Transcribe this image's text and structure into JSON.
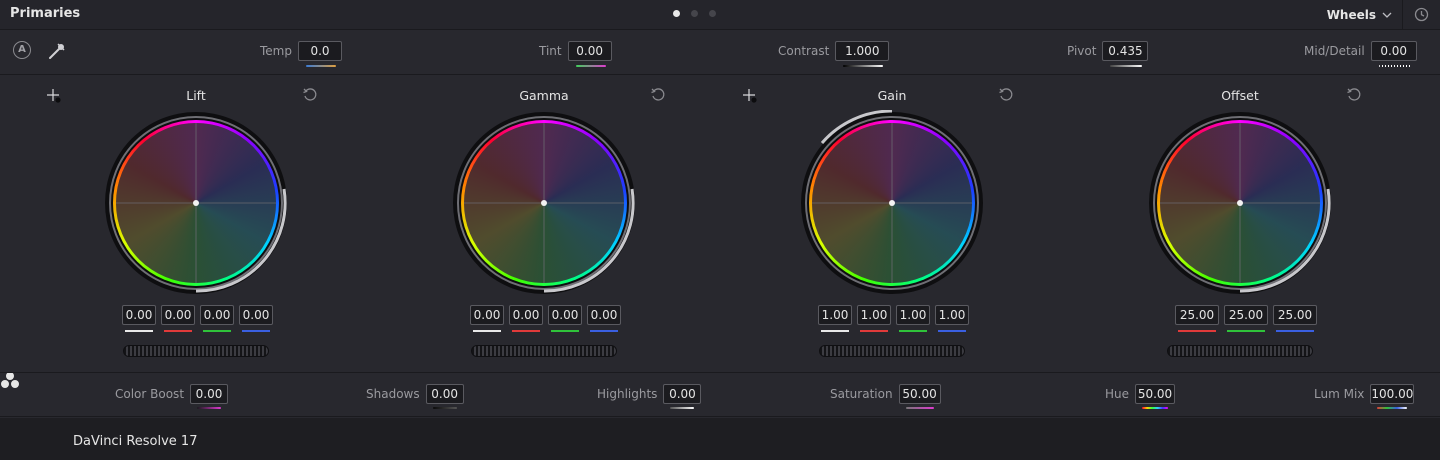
{
  "header": {
    "title": "Primaries",
    "mode": "Wheels",
    "pages": [
      true,
      false,
      false
    ]
  },
  "top_controls": [
    {
      "key": "temp",
      "label": "Temp",
      "value": "0.0"
    },
    {
      "key": "tint",
      "label": "Tint",
      "value": "0.00"
    },
    {
      "key": "contrast",
      "label": "Contrast",
      "value": "1.000"
    },
    {
      "key": "pivot",
      "label": "Pivot",
      "value": "0.435"
    },
    {
      "key": "mid_detail",
      "label": "Mid/Detail",
      "value": "0.00"
    }
  ],
  "wheels": [
    {
      "name": "Lift",
      "values": [
        "0.00",
        "0.00",
        "0.00",
        "0.00"
      ]
    },
    {
      "name": "Gamma",
      "values": [
        "0.00",
        "0.00",
        "0.00",
        "0.00"
      ]
    },
    {
      "name": "Gain",
      "values": [
        "1.00",
        "1.00",
        "1.00",
        "1.00"
      ]
    },
    {
      "name": "Offset",
      "values": [
        "25.00",
        "25.00",
        "25.00"
      ]
    }
  ],
  "bottom_controls": [
    {
      "key": "color_boost",
      "label": "Color Boost",
      "value": "0.00"
    },
    {
      "key": "shadows",
      "label": "Shadows",
      "value": "0.00"
    },
    {
      "key": "highlights",
      "label": "Highlights",
      "value": "0.00"
    },
    {
      "key": "saturation",
      "label": "Saturation",
      "value": "50.00"
    },
    {
      "key": "hue",
      "label": "Hue",
      "value": "50.00"
    },
    {
      "key": "lum_mix",
      "label": "Lum Mix",
      "value": "100.00"
    }
  ],
  "footer": {
    "app_name": "DaVinci Resolve 17"
  },
  "colors": {
    "accent_red": "#e03a3a",
    "accent_green": "#2fc23a",
    "accent_blue": "#3a5fe0",
    "white": "#e8e8e8"
  },
  "icons": {
    "auto": "auto-balance-icon",
    "picker": "eyedropper-icon",
    "reset": "reset-icon",
    "history": "history-icon",
    "crosshair": "crosshair-icon"
  }
}
